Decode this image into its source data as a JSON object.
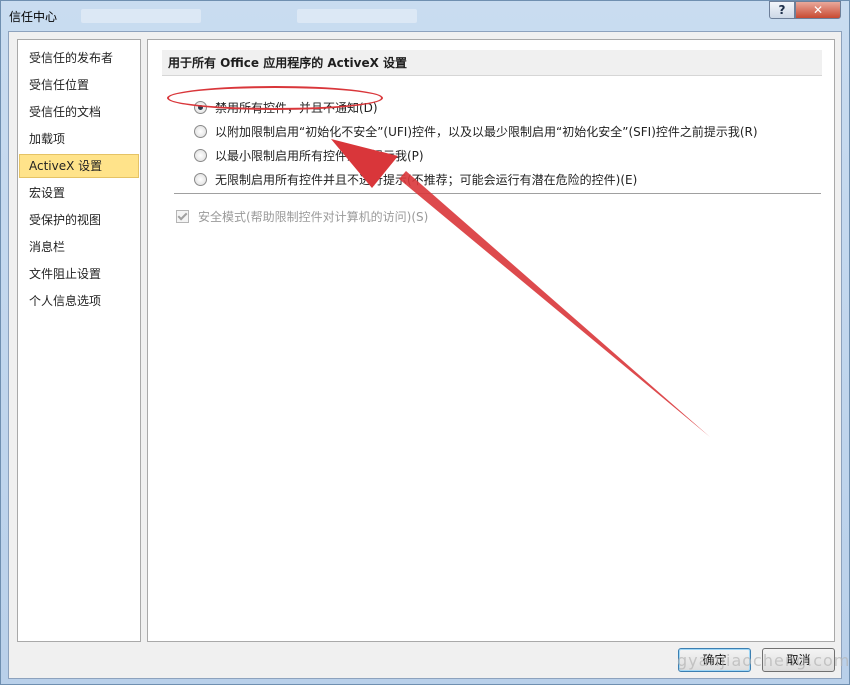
{
  "window": {
    "title": "信任中心",
    "help_glyph": "?",
    "close_glyph": "✕"
  },
  "sidebar": {
    "items": [
      {
        "label": "受信任的发布者",
        "active": false
      },
      {
        "label": "受信任位置",
        "active": false
      },
      {
        "label": "受信任的文档",
        "active": false
      },
      {
        "label": "加载项",
        "active": false
      },
      {
        "label": "ActiveX 设置",
        "active": true
      },
      {
        "label": "宏设置",
        "active": false
      },
      {
        "label": "受保护的视图",
        "active": false
      },
      {
        "label": "消息栏",
        "active": false
      },
      {
        "label": "文件阻止设置",
        "active": false
      },
      {
        "label": "个人信息选项",
        "active": false
      }
    ]
  },
  "main": {
    "section_title": "用于所有 Office 应用程序的 ActiveX 设置",
    "options": [
      {
        "label": "禁用所有控件，并且不通知(D)",
        "selected": true
      },
      {
        "label": "以附加限制启用“初始化不安全”(UFI)控件，以及以最少限制启用“初始化安全”(SFI)控件之前提示我(R)",
        "selected": false
      },
      {
        "label": "以最小限制启用所有控件之前提示我(P)",
        "selected": false
      },
      {
        "label": "无限制启用所有控件并且不进行提示(不推荐；可能会运行有潜在危险的控件)(E)",
        "selected": false
      }
    ],
    "safe_mode": {
      "label": "安全模式(帮助限制控件对计算机的访问)(S)",
      "checked": true,
      "enabled": false
    }
  },
  "buttons": {
    "ok": "确定",
    "cancel": "取消"
  },
  "annotation": {
    "color": "#d9363a"
  },
  "watermark": "gyanjiaocheng.com"
}
